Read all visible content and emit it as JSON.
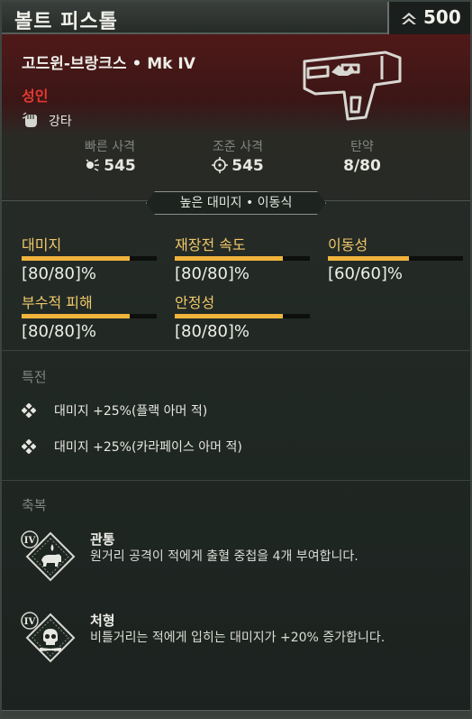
{
  "window": {
    "title": "볼트 피스톨"
  },
  "cost": {
    "icon": "rank-chevron-icon",
    "value": "500"
  },
  "weapon": {
    "name": "고드윈-브랑크스 • Mk IV",
    "rarity": "성인",
    "rarity_color": "#e23a33",
    "attack_icon": "fist-icon",
    "attack_type": "강타",
    "image": "bolt-pistol-icon"
  },
  "stats": [
    {
      "label": "빠른 사격",
      "icon": "burst-icon",
      "value": "545"
    },
    {
      "label": "조준 사격",
      "icon": "crosshair-icon",
      "value": "545"
    },
    {
      "label": "탄약",
      "value": "8/80"
    }
  ],
  "banner": "높은 대미지 • 이동식",
  "bars": [
    {
      "label": "대미지",
      "value": "[80/80]%",
      "fill": 0.8
    },
    {
      "label": "재장전 속도",
      "value": "[80/80]%",
      "fill": 0.8
    },
    {
      "label": "이동성",
      "value": "[60/60]%",
      "fill": 0.6
    },
    {
      "label": "부수적 피해",
      "value": "[80/80]%",
      "fill": 0.8
    },
    {
      "label": "안정성",
      "value": "[80/80]%",
      "fill": 0.8
    }
  ],
  "accent_color": "#f0b43c",
  "perks": {
    "title": "특전",
    "items": [
      {
        "icon": "diamond-bullet-icon",
        "text": "대미지 +25%(플랙 아머 적)"
      },
      {
        "icon": "diamond-bullet-icon",
        "text": "대미지 +25%(카라페이스 아머 적)"
      }
    ]
  },
  "blessings": {
    "title": "축복",
    "items": [
      {
        "tier": "IV",
        "icon": "bleeding-beast-icon",
        "name": "관통",
        "desc": "원거리 공격이 적에게 출혈 중첩을 4개 부여합니다."
      },
      {
        "tier": "IV",
        "icon": "skull-icon",
        "name": "처형",
        "desc": "비틀거리는 적에게 입히는 대미지가 +20% 증가합니다."
      }
    ]
  }
}
